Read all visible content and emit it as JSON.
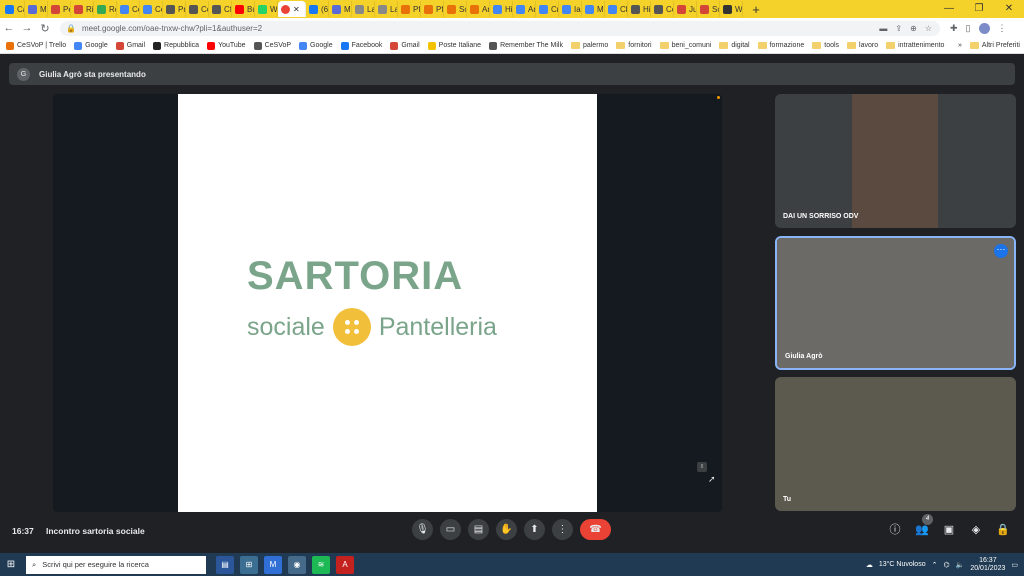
{
  "browser": {
    "tabs": [
      {
        "label": "Ca",
        "color": "#1877f2"
      },
      {
        "label": "M",
        "color": "#5b6bd6"
      },
      {
        "label": "Pe",
        "color": "#d44638"
      },
      {
        "label": "Ri",
        "color": "#d44638"
      },
      {
        "label": "Re",
        "color": "#34a853"
      },
      {
        "label": "Co",
        "color": "#4285f4"
      },
      {
        "label": "Ce",
        "color": "#4285f4"
      },
      {
        "label": "Pr",
        "color": "#555555"
      },
      {
        "label": "Cc",
        "color": "#555555"
      },
      {
        "label": "Cf",
        "color": "#555555"
      },
      {
        "label": "Bu",
        "color": "#ff0000"
      },
      {
        "label": "W",
        "color": "#25d366"
      }
    ],
    "active_tab_close": "✕",
    "tabs_after": [
      {
        "label": "(6",
        "color": "#1877f2"
      },
      {
        "label": "M",
        "color": "#5b6bd6"
      },
      {
        "label": "La",
        "color": "#888888"
      },
      {
        "label": "La",
        "color": "#888888"
      },
      {
        "label": "Pf",
        "color": "#e8710a"
      },
      {
        "label": "Pf",
        "color": "#e8710a"
      },
      {
        "label": "Sc",
        "color": "#e8710a"
      },
      {
        "label": "Ar",
        "color": "#e8710a"
      },
      {
        "label": "Hi",
        "color": "#4285f4"
      },
      {
        "label": "Ar",
        "color": "#4285f4"
      },
      {
        "label": "Cr",
        "color": "#4285f4"
      },
      {
        "label": "Ia",
        "color": "#4285f4"
      },
      {
        "label": "M",
        "color": "#4285f4"
      },
      {
        "label": "Cl",
        "color": "#4285f4"
      },
      {
        "label": "Hi",
        "color": "#555555"
      },
      {
        "label": "Cc",
        "color": "#555555"
      },
      {
        "label": "Ju",
        "color": "#d44638"
      },
      {
        "label": "Sc",
        "color": "#d44638"
      },
      {
        "label": "W",
        "color": "#333333"
      }
    ],
    "new_tab": "+",
    "url": "meet.google.com/oae-tnxw-chw?pli=1&authuser=2",
    "bookmarks": [
      {
        "label": "CeSVoP | Trello",
        "color": "#e8710a"
      },
      {
        "label": "Google",
        "color": "#4285f4"
      },
      {
        "label": "Gmail",
        "color": "#d44638"
      },
      {
        "label": "Repubblica",
        "color": "#222222"
      },
      {
        "label": "YouTube",
        "color": "#ff0000"
      },
      {
        "label": "CeSVoP",
        "color": "#555555"
      },
      {
        "label": "Google",
        "color": "#4285f4"
      },
      {
        "label": "Facebook",
        "color": "#1877f2"
      },
      {
        "label": "Gmail",
        "color": "#d44638"
      },
      {
        "label": "Poste Italiane",
        "color": "#f2c200"
      },
      {
        "label": "Remember The Milk",
        "color": "#555555"
      }
    ],
    "bookmark_folders": [
      "palermo",
      "fornitori",
      "beni_comuni",
      "digital",
      "formazione",
      "tools",
      "lavoro",
      "intrattenimento"
    ],
    "bookmarks_more": "»",
    "other_favorites": "Altri Preferiti"
  },
  "meet": {
    "presenter_initial": "G",
    "presenting_text": "Giulia Agrò sta presentando",
    "slide": {
      "logo_line1": "SARTORIA",
      "logo_word_left": "sociale",
      "logo_word_right": "Pantelleria"
    },
    "page_indicator": "8",
    "participants": [
      {
        "name": "DAI UN SORRISO ODV"
      },
      {
        "name": "Giulia Agrò"
      },
      {
        "name": "Tu"
      }
    ],
    "time": "16:37",
    "meeting_name": "Incontro sartoria sociale",
    "participant_count": "4"
  },
  "taskbar": {
    "search_placeholder": "Scrivi qui per eseguire la ricerca",
    "weather": "13°C  Nuvoloso",
    "clock_time": "16:37",
    "clock_date": "20/01/2023"
  }
}
